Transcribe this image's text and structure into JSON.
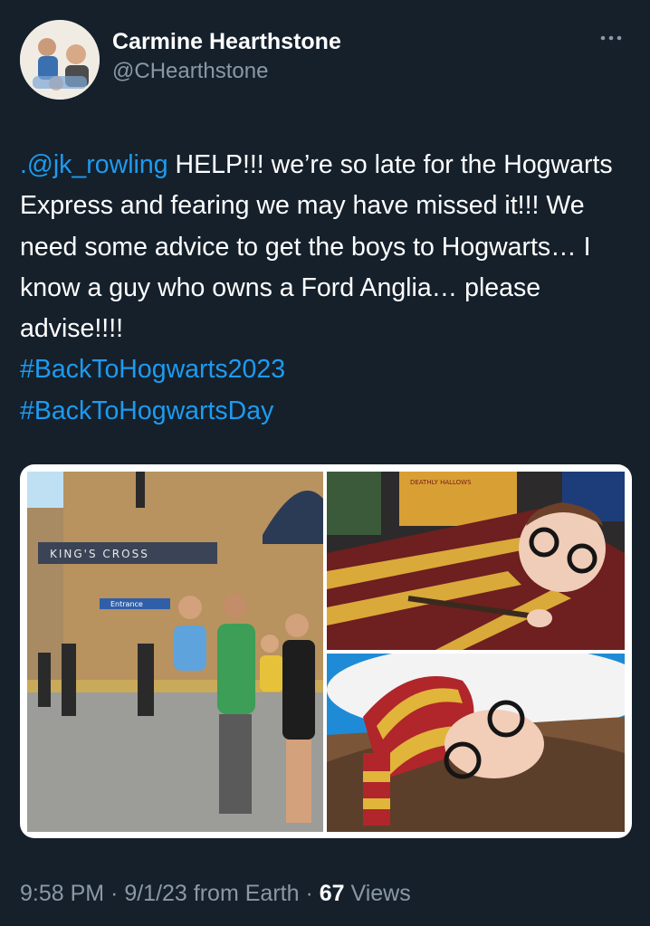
{
  "author": {
    "display_name": "Carmine Hearthstone",
    "handle": "@CHearthstone",
    "avatar_icon": "profile-avatar"
  },
  "more_icon": "more-options-icon",
  "tweet": {
    "mention": ".@jk_rowling",
    "body": " HELP!!! we’re so late for the Hogwarts Express and fearing we may have missed it!!! We need some advice to get the boys to Hogwarts… I know a guy who owns a Ford Anglia… please advise!!!!",
    "hashtags": [
      "#BackToHogwarts2023",
      "#BackToHogwartsDay"
    ]
  },
  "media": {
    "photo1_sign": "KING'S  CROSS",
    "photo1_entrance": "Entrance",
    "photo2_book": "DEATHLY HALLOWS"
  },
  "meta": {
    "time": "9:58 PM",
    "sep1": " · ",
    "date": "9/1/23",
    "source": " from Earth",
    "sep2": " · ",
    "views_count": "67",
    "views_label": " Views"
  },
  "colors": {
    "background": "#15202b",
    "link": "#1d9bf0",
    "secondary_text": "#8b98a5"
  }
}
